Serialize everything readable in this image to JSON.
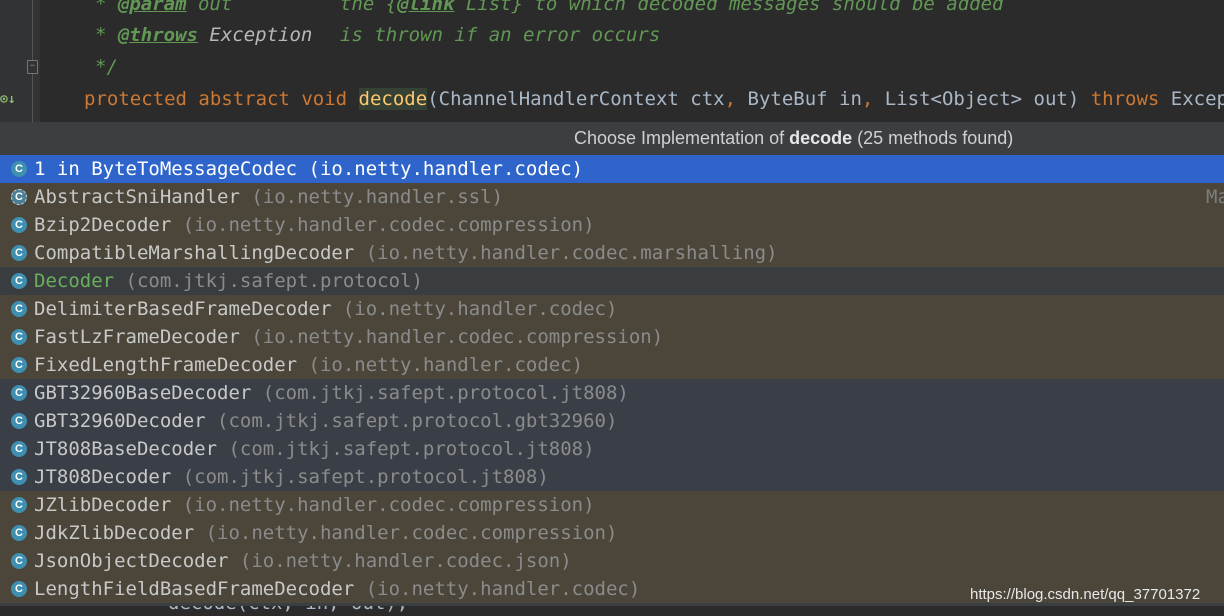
{
  "editor": {
    "line1": {
      "star": "* ",
      "tag": "@param",
      "param": " out",
      "desc": "the {",
      "link": "@link",
      "desc2": " List} to which decoded messages should be added"
    },
    "line2": {
      "star": "* ",
      "tag": "@throws",
      "param": " Exception",
      "desc": "is thrown if an error occurs"
    },
    "line3": {
      "text": "*/"
    },
    "line4": {
      "kw1": "protected abstract void ",
      "method": "decode",
      "sig1": "(ChannelHandlerContext ctx",
      "comma1": ",",
      "sig2": " ByteBuf in",
      "comma2": ",",
      "sig3": " List<Object> out) ",
      "throws": "throws",
      "sig4": " Exception;"
    },
    "bottom_fragment": "decode(ctx, in, out);"
  },
  "popup": {
    "title_prefix": "Choose Implementation of ",
    "title_method": "decode",
    "title_suffix": " (25 methods found)",
    "items": [
      {
        "icon": "C",
        "name": "1 in ByteToMessageCodec (io.netty.handler.codec)",
        "package": "",
        "selected": true
      },
      {
        "icon": "C",
        "name": "AbstractSniHandler",
        "package": " (io.netty.handler.ssl)",
        "right_text": "Ma"
      },
      {
        "icon": "C",
        "name": "Bzip2Decoder",
        "package": " (io.netty.handler.codec.compression)"
      },
      {
        "icon": "C",
        "name": "CompatibleMarshallingDecoder",
        "package": " (io.netty.handler.codec.marshalling)"
      },
      {
        "icon": "C",
        "name": "Decoder",
        "package": " (com.jtkj.safept.protocol)"
      },
      {
        "icon": "C",
        "name": "DelimiterBasedFrameDecoder",
        "package": " (io.netty.handler.codec)"
      },
      {
        "icon": "C",
        "name": "FastLzFrameDecoder",
        "package": " (io.netty.handler.codec.compression)"
      },
      {
        "icon": "C",
        "name": "FixedLengthFrameDecoder",
        "package": " (io.netty.handler.codec)"
      },
      {
        "icon": "C",
        "name": "GBT32960BaseDecoder",
        "package": " (com.jtkj.safept.protocol.jt808)"
      },
      {
        "icon": "C",
        "name": "GBT32960Decoder",
        "package": " (com.jtkj.safept.protocol.gbt32960)"
      },
      {
        "icon": "C",
        "name": "JT808BaseDecoder",
        "package": " (com.jtkj.safept.protocol.jt808)"
      },
      {
        "icon": "C",
        "name": "JT808Decoder",
        "package": " (com.jtkj.safept.protocol.jt808)"
      },
      {
        "icon": "C",
        "name": "JZlibDecoder",
        "package": " (io.netty.handler.codec.compression)"
      },
      {
        "icon": "C",
        "name": "JdkZlibDecoder",
        "package": " (io.netty.handler.codec.compression)"
      },
      {
        "icon": "C",
        "name": "JsonObjectDecoder",
        "package": " (io.netty.handler.codec.json)"
      },
      {
        "icon": "C",
        "name": "LengthFieldBasedFrameDecoder",
        "package": " (io.netty.handler.codec)"
      }
    ]
  },
  "watermark": "https://blog.csdn.net/qq_37701372"
}
